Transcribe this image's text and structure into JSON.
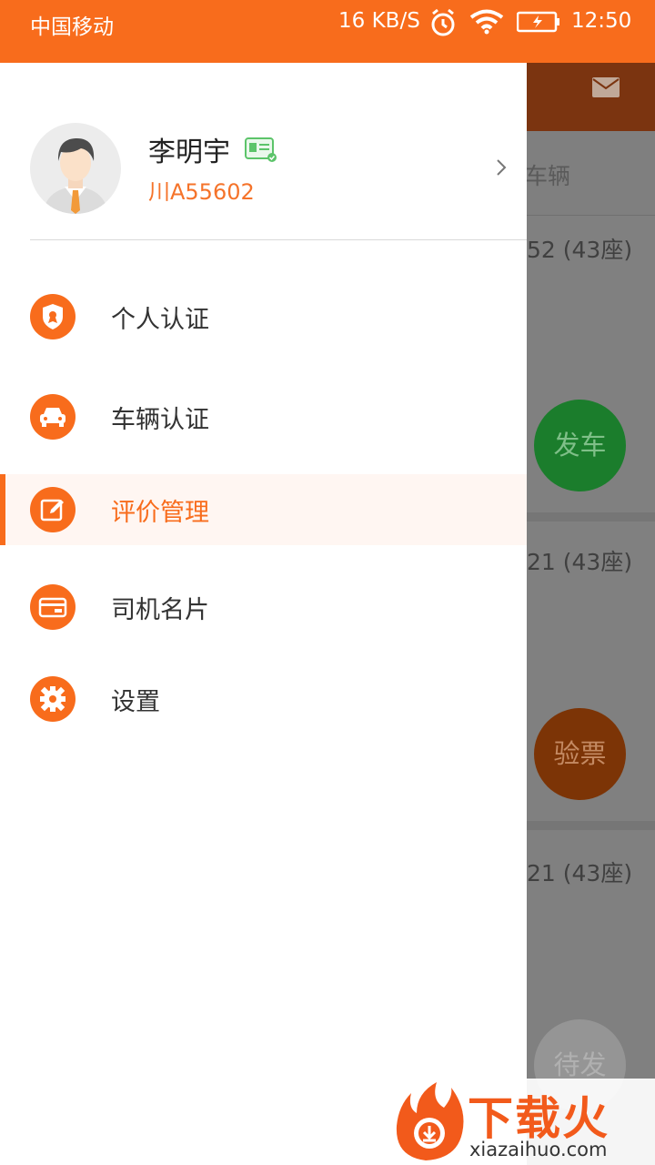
{
  "status_bar": {
    "carrier": "中国移动",
    "speed": "16 KB/S",
    "time": "12:50"
  },
  "profile": {
    "name": "李明宇",
    "plate": "川A55602"
  },
  "menu": [
    {
      "label": "个人认证",
      "icon": "shield-icon"
    },
    {
      "label": "车辆认证",
      "icon": "car-icon"
    },
    {
      "label": "评价管理",
      "icon": "edit-icon",
      "active": true
    },
    {
      "label": "司机名片",
      "icon": "card-icon"
    },
    {
      "label": "设置",
      "icon": "gear-icon"
    }
  ],
  "background": {
    "tab_label": "车辆",
    "cards": [
      {
        "seat_text": "52 (43座)",
        "action": "发车"
      },
      {
        "seat_text": "21 (43座)",
        "action": "验票"
      },
      {
        "seat_text": "21 (43座)",
        "action": "待发"
      }
    ]
  },
  "watermark": {
    "title": "下载火",
    "url": "xiazaihuo.com"
  },
  "colors": {
    "accent": "#f86c1c",
    "plate_text": "#f5732a",
    "active_bg": "#fff6f2",
    "fab_green": "#1b7d2c",
    "fab_brown": "#7c3406"
  }
}
